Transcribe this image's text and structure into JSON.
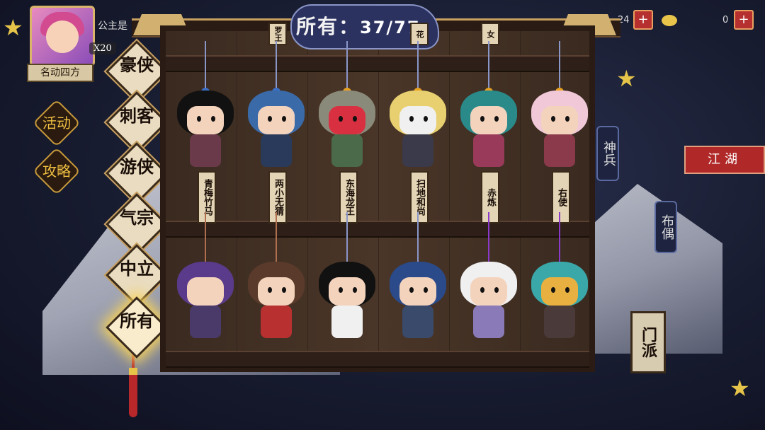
{
  "player": {
    "name": "公主是",
    "power": "X20",
    "title": "名动四方"
  },
  "side_buttons": {
    "event": "活动",
    "strategy": "攻略"
  },
  "categories": [
    {
      "label": "豪侠",
      "active": false
    },
    {
      "label": "刺客",
      "active": false
    },
    {
      "label": "游侠",
      "active": false
    },
    {
      "label": "气宗",
      "active": false
    },
    {
      "label": "中立",
      "active": false
    },
    {
      "label": "所有",
      "active": true
    }
  ],
  "collection": {
    "label": "所有：",
    "count": "37/77"
  },
  "resources": [
    {
      "name": "gold-ingot",
      "value": "24"
    },
    {
      "name": "silver-ingot",
      "value": "0"
    }
  ],
  "right_menu": {
    "shenbing": "神兵",
    "buou": "布偶",
    "jianghu": "江湖",
    "menpai": "门派"
  },
  "top_row_hidden_tags": [
    "",
    "罗王",
    "",
    "花",
    "女",
    ""
  ],
  "figures": [
    {
      "name": "青梅竹马",
      "row": 1
    },
    {
      "name": "两小无猜",
      "row": 1
    },
    {
      "name": "东海龙王",
      "row": 1
    },
    {
      "name": "扫地和尚",
      "row": 1
    },
    {
      "name": "赤炼",
      "row": 1
    },
    {
      "name": "右使",
      "row": 1
    },
    {
      "name": "",
      "row": 2
    },
    {
      "name": "",
      "row": 2
    },
    {
      "name": "",
      "row": 2
    },
    {
      "name": "",
      "row": 2
    },
    {
      "name": "",
      "row": 2
    },
    {
      "name": "",
      "row": 2
    }
  ],
  "colors": {
    "accent_red": "#b02828",
    "gold": "#e6c44a",
    "wood_dark": "#2a1c14"
  }
}
